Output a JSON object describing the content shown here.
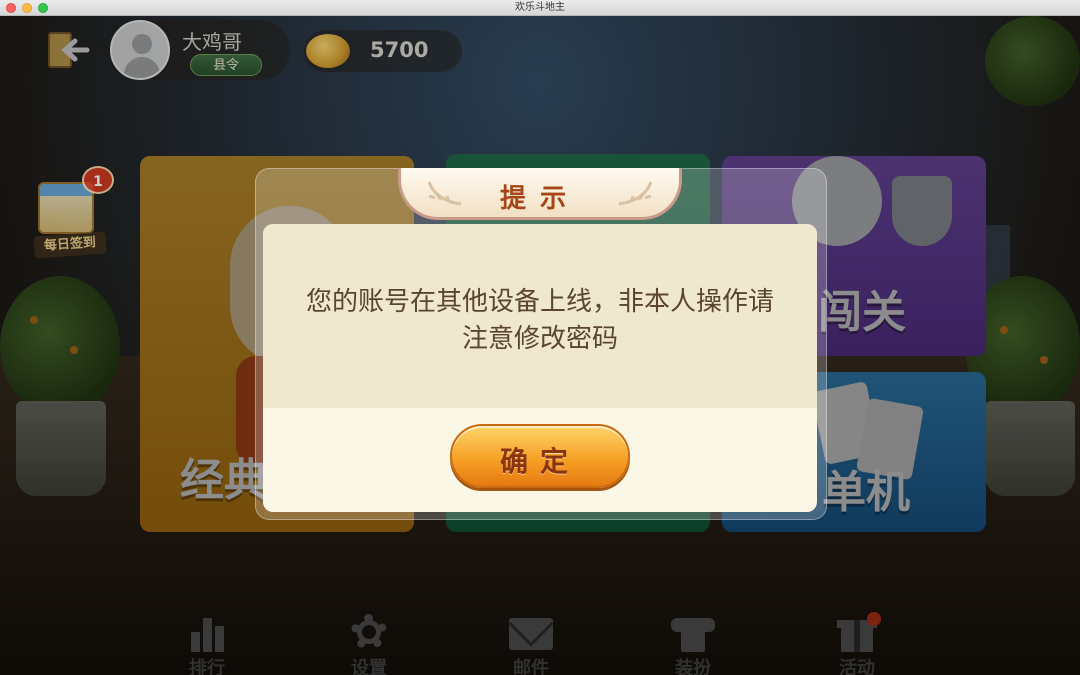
{
  "window": {
    "title": "欢乐斗地主"
  },
  "player": {
    "name": "大鸡哥",
    "rank": "县令",
    "coins": "5700"
  },
  "daily": {
    "label": "每日签到",
    "badge": "1"
  },
  "modes": [
    {
      "label": "经典"
    },
    {
      "label": "闯关"
    },
    {
      "label": "单机"
    }
  ],
  "dialog": {
    "title": "提示",
    "message": "您的账号在其他设备上线，非本人操作请注意修改密码",
    "confirm": "确定"
  },
  "nav": [
    {
      "label": "排行",
      "icon": "ranking-icon"
    },
    {
      "label": "设置",
      "icon": "gear-icon"
    },
    {
      "label": "邮件",
      "icon": "mail-icon"
    },
    {
      "label": "装扮",
      "icon": "shirt-icon"
    },
    {
      "label": "活动",
      "icon": "gift-icon"
    }
  ],
  "colors": {
    "dialog_bg": "#fbf7e6",
    "title_text": "#a64516",
    "button_orange": "#f6a126"
  }
}
